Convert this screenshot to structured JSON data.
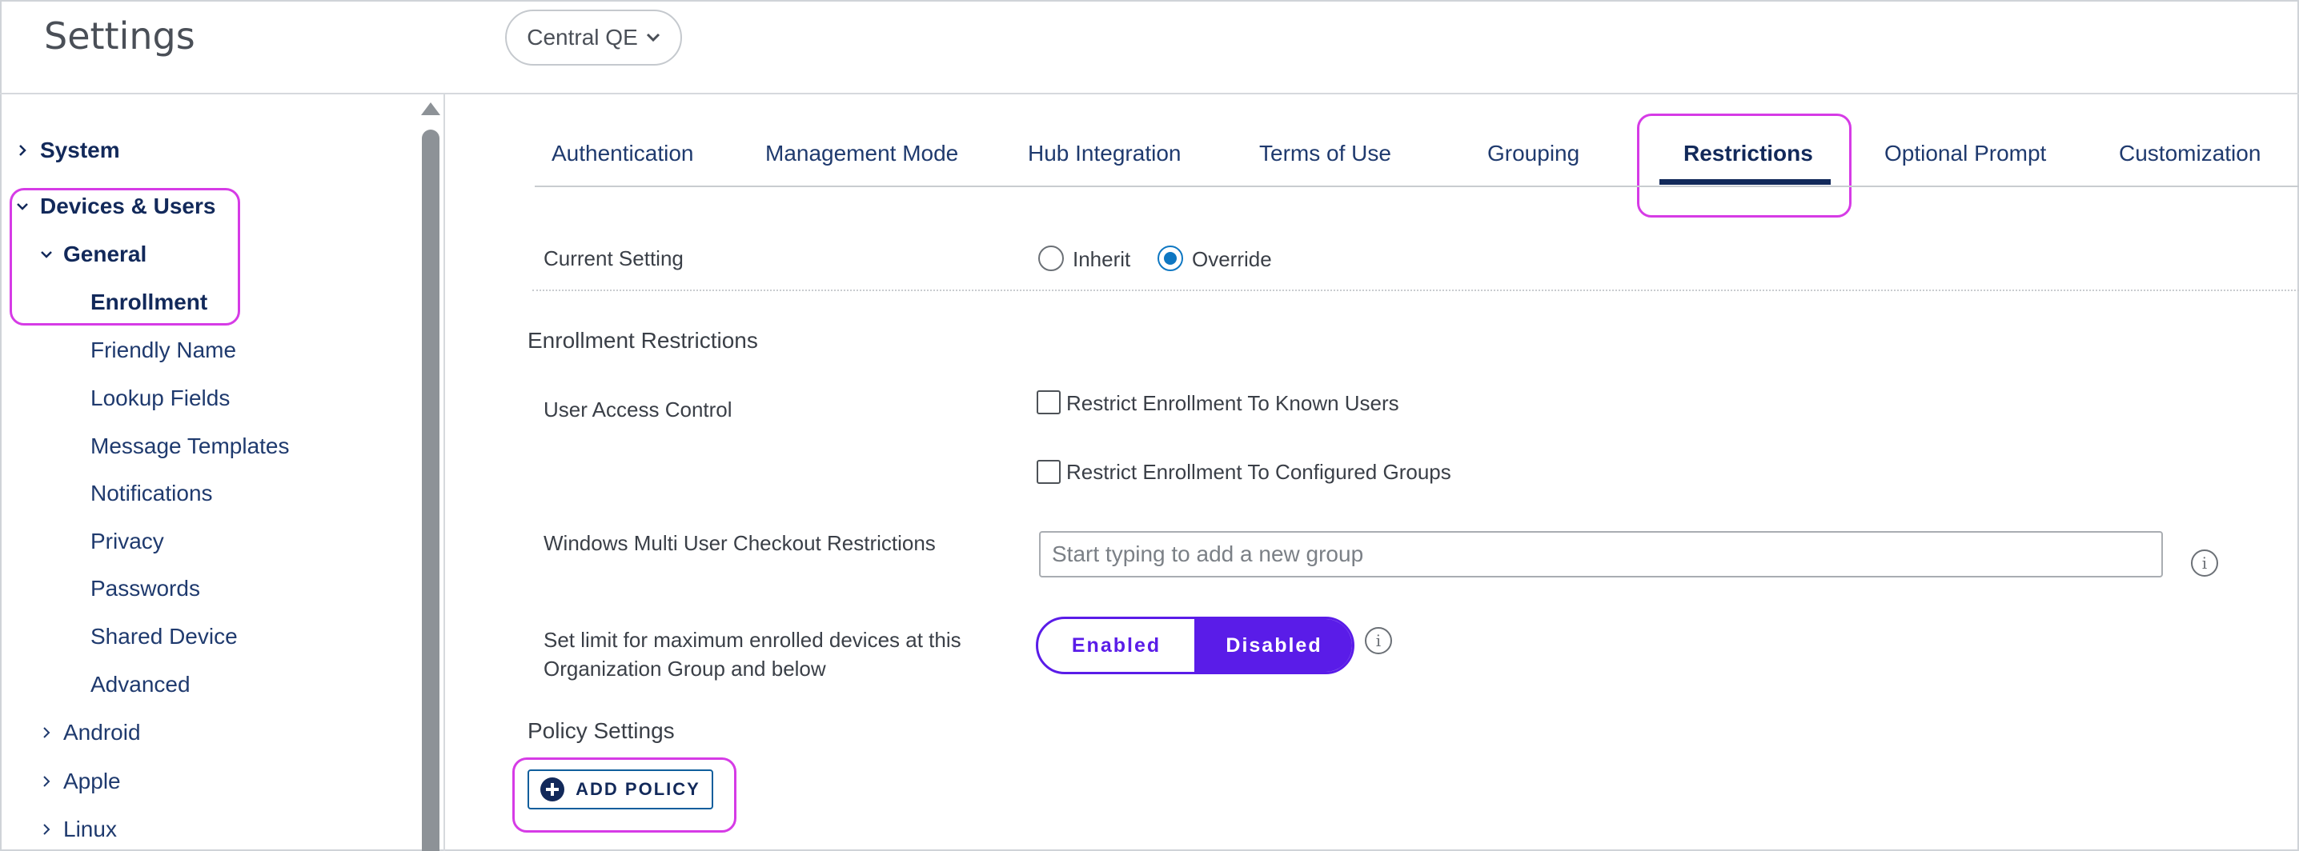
{
  "header": {
    "title": "Settings",
    "org_group": "Central QE"
  },
  "sidebar": {
    "system": "System",
    "devices_users": "Devices & Users",
    "general": "General",
    "items": [
      "Enrollment",
      "Friendly Name",
      "Lookup Fields",
      "Message Templates",
      "Notifications",
      "Privacy",
      "Passwords",
      "Shared Device",
      "Advanced"
    ],
    "android": "Android",
    "apple": "Apple",
    "linux": "Linux"
  },
  "tabs": [
    "Authentication",
    "Management Mode",
    "Hub Integration",
    "Terms of Use",
    "Grouping",
    "Restrictions",
    "Optional Prompt",
    "Customization"
  ],
  "active_tab": "Restrictions",
  "form": {
    "current_setting_label": "Current Setting",
    "inherit": "Inherit",
    "override": "Override",
    "selected": "Override",
    "enrollment_restrictions_title": "Enrollment Restrictions",
    "user_access_control_label": "User Access Control",
    "restrict_known_users": "Restrict Enrollment To Known Users",
    "restrict_configured_groups": "Restrict Enrollment To Configured Groups",
    "windows_multi_user_label": "Windows Multi User Checkout Restrictions",
    "group_placeholder": "Start typing to add a new group",
    "max_enrolled_label_line1": "Set limit for maximum enrolled devices at this",
    "max_enrolled_label_line2": "Organization Group and below",
    "enabled": "Enabled",
    "disabled": "Disabled",
    "toggle_selected": "Disabled",
    "policy_settings_title": "Policy Settings",
    "add_policy": "ADD POLICY",
    "info_glyph": "i"
  },
  "colors": {
    "accent_purple": "#5a1ce8",
    "highlight_magenta": "#d63be6",
    "nav_navy": "#12295a",
    "radio_blue": "#0e77c2"
  }
}
